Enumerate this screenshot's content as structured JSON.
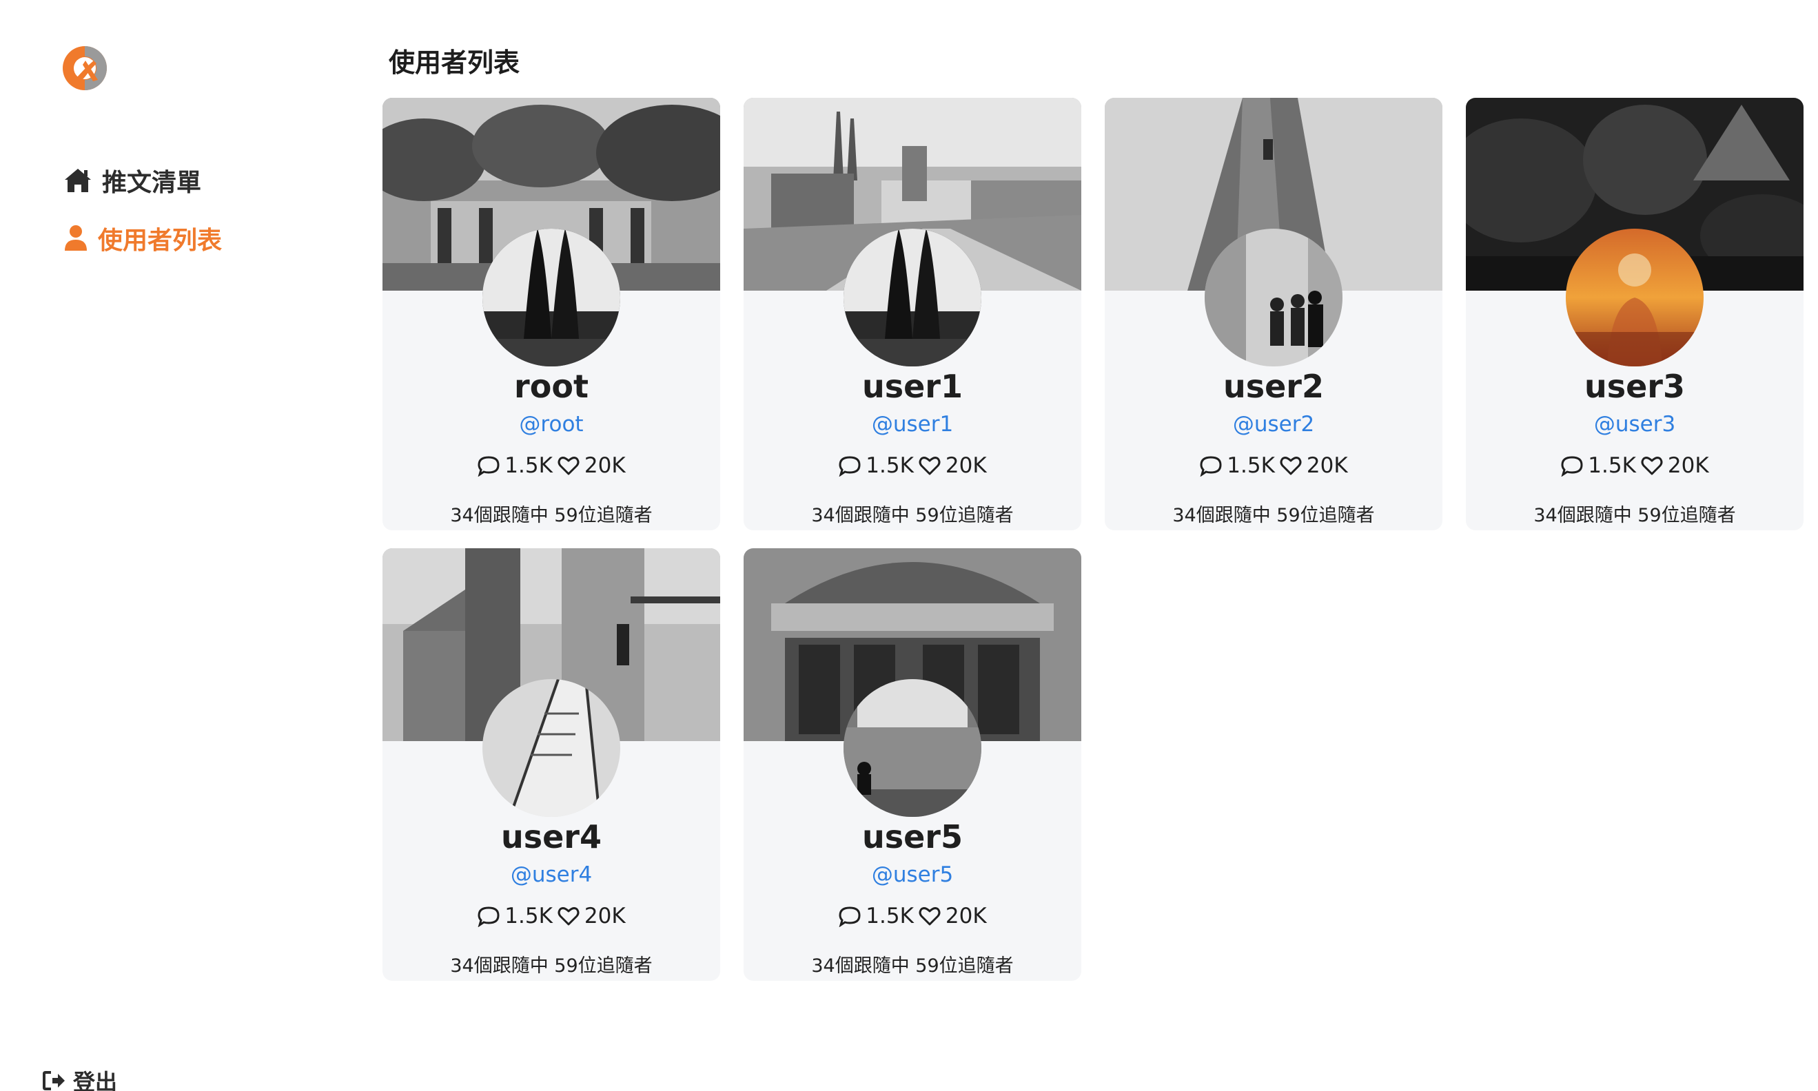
{
  "brand": {
    "accent": "#f07a2c",
    "nav_text": "#2d2d2d",
    "handle": "#2f7fe0",
    "card_bg": "#f5f6f8"
  },
  "sidebar": {
    "logo_icon": "alphitter-logo",
    "items": [
      {
        "label": "推文清單",
        "icon": "home-icon",
        "active": false
      },
      {
        "label": "使用者列表",
        "icon": "user-icon",
        "active": true
      }
    ],
    "logout": {
      "label": "登出",
      "icon": "logout-icon"
    }
  },
  "main": {
    "title": "使用者列表",
    "users": [
      {
        "name": "root",
        "handle": "@root",
        "replies": "1.5K",
        "likes": "20K",
        "follow": "34個跟隨中 59位追隨者"
      },
      {
        "name": "user1",
        "handle": "@user1",
        "replies": "1.5K",
        "likes": "20K",
        "follow": "34個跟隨中 59位追隨者"
      },
      {
        "name": "user2",
        "handle": "@user2",
        "replies": "1.5K",
        "likes": "20K",
        "follow": "34個跟隨中 59位追隨者"
      },
      {
        "name": "user3",
        "handle": "@user3",
        "replies": "1.5K",
        "likes": "20K",
        "follow": "34個跟隨中 59位追隨者"
      },
      {
        "name": "user4",
        "handle": "@user4",
        "replies": "1.5K",
        "likes": "20K",
        "follow": "34個跟隨中 59位追隨者"
      },
      {
        "name": "user5",
        "handle": "@user5",
        "replies": "1.5K",
        "likes": "20K",
        "follow": "34個跟隨中 59位追隨者"
      }
    ]
  }
}
